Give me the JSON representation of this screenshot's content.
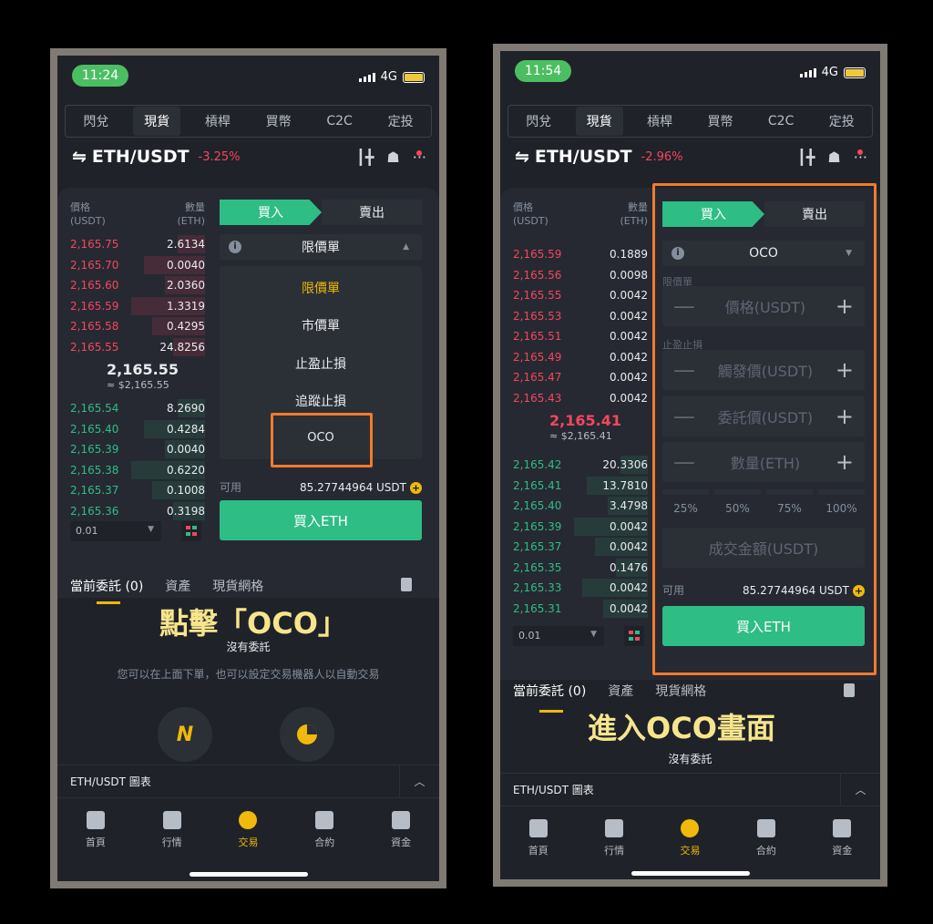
{
  "screen1": {
    "time": "11:24",
    "network": "4G",
    "tabs": [
      "閃兌",
      "現貨",
      "槓桿",
      "買幣",
      "C2C",
      "定投"
    ],
    "pair": "ETH/USDT",
    "change": "-3.25%",
    "ob_header": {
      "price_label": "價格",
      "price_unit": "(USDT)",
      "qty_label": "數量",
      "qty_unit": "(ETH)"
    },
    "asks": [
      {
        "price": "2,165.75",
        "qty": "2.6134"
      },
      {
        "price": "2,165.70",
        "qty": "0.0040"
      },
      {
        "price": "2,165.60",
        "qty": "2.0360"
      },
      {
        "price": "2,165.59",
        "qty": "1.3319"
      },
      {
        "price": "2,165.58",
        "qty": "0.4295"
      },
      {
        "price": "2,165.55",
        "qty": "24.8256"
      }
    ],
    "mid_price": "2,165.55",
    "mid_sub": "≈ $2,165.55",
    "bids": [
      {
        "price": "2,165.54",
        "qty": "8.2690"
      },
      {
        "price": "2,165.40",
        "qty": "0.4284"
      },
      {
        "price": "2,165.39",
        "qty": "0.0040"
      },
      {
        "price": "2,165.38",
        "qty": "0.6220"
      },
      {
        "price": "2,165.37",
        "qty": "0.1008"
      },
      {
        "price": "2,165.36",
        "qty": "0.3198"
      }
    ],
    "depth": "0.01",
    "buy_label": "買入",
    "sell_label": "賣出",
    "order_type": "限價單",
    "dropdown": [
      "限價單",
      "市價單",
      "止盈止損",
      "追蹤止損",
      "OCO"
    ],
    "available_label": "可用",
    "available_value": "85.27744964 USDT",
    "buy_button": "買入ETH",
    "order_tabs": [
      "當前委託 (0)",
      "資產",
      "現貨網格"
    ],
    "caption": "點擊「OCO」",
    "no_orders": "沒有委託",
    "hint": "您可以在上面下單，也可以設定交易機器人以自動交易",
    "chart_bar": "ETH/USDT 圖表",
    "nav": [
      "首頁",
      "行情",
      "交易",
      "合約",
      "資金"
    ]
  },
  "screen2": {
    "time": "11:54",
    "network": "4G",
    "tabs": [
      "閃兌",
      "現貨",
      "槓桿",
      "買幣",
      "C2C",
      "定投"
    ],
    "pair": "ETH/USDT",
    "change": "-2.96%",
    "ob_header": {
      "price_label": "價格",
      "price_unit": "(USDT)",
      "qty_label": "數量",
      "qty_unit": "(ETH)"
    },
    "asks": [
      {
        "price": "2,165.59",
        "qty": "0.1889"
      },
      {
        "price": "2,165.56",
        "qty": "0.0098"
      },
      {
        "price": "2,165.55",
        "qty": "0.0042"
      },
      {
        "price": "2,165.53",
        "qty": "0.0042"
      },
      {
        "price": "2,165.51",
        "qty": "0.0042"
      },
      {
        "price": "2,165.49",
        "qty": "0.0042"
      },
      {
        "price": "2,165.47",
        "qty": "0.0042"
      },
      {
        "price": "2,165.43",
        "qty": "0.0042"
      }
    ],
    "mid_price": "2,165.41",
    "mid_sub": "≈ $2,165.41",
    "bids": [
      {
        "price": "2,165.42",
        "qty": "20.3306"
      },
      {
        "price": "2,165.41",
        "qty": "13.7810"
      },
      {
        "price": "2,165.40",
        "qty": "3.4798"
      },
      {
        "price": "2,165.39",
        "qty": "0.0042"
      },
      {
        "price": "2,165.37",
        "qty": "0.0042"
      },
      {
        "price": "2,165.35",
        "qty": "0.1476"
      },
      {
        "price": "2,165.33",
        "qty": "0.0042"
      },
      {
        "price": "2,165.31",
        "qty": "0.0042"
      }
    ],
    "depth": "0.01",
    "buy_label": "買入",
    "sell_label": "賣出",
    "order_type": "OCO",
    "limit_section": "限價單",
    "price_field": "價格(USDT)",
    "stop_section": "止盈止損",
    "trigger_field": "觸發價(USDT)",
    "stop_price_field": "委託價(USDT)",
    "qty_field": "數量(ETH)",
    "percents": [
      "25%",
      "50%",
      "75%",
      "100%"
    ],
    "total_field": "成交金額(USDT)",
    "available_label": "可用",
    "available_value": "85.27744964 USDT",
    "buy_button": "買入ETH",
    "order_tabs": [
      "當前委託 (0)",
      "資產",
      "現貨網格"
    ],
    "caption": "進入OCO畫面",
    "no_orders": "沒有委託",
    "chart_bar": "ETH/USDT 圖表",
    "nav": [
      "首頁",
      "行情",
      "交易",
      "合約",
      "資金"
    ]
  }
}
